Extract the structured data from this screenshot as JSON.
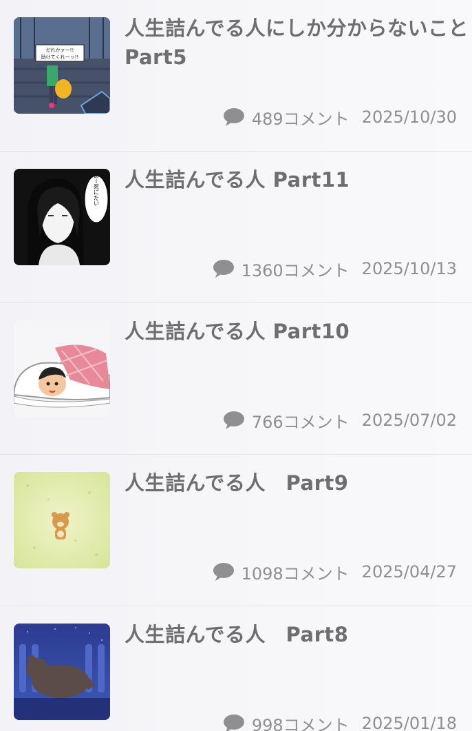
{
  "items": [
    {
      "title": "人生詰んでる人にしか分からないことPart5",
      "comments": "489コメント",
      "date": "2025/10/30",
      "thumb_text": [
        "だれかァー!!",
        "助けてくれーッ!!"
      ]
    },
    {
      "title": "人生詰んでる人 Part11",
      "comments": "1360コメント",
      "date": "2025/10/13",
      "thumb_text": [
        "あー死にたい"
      ]
    },
    {
      "title": "人生詰んでる人 Part10",
      "comments": "766コメント",
      "date": "2025/07/02"
    },
    {
      "title": "人生詰んでる人　Part9",
      "comments": "1098コメント",
      "date": "2025/04/27"
    },
    {
      "title": "人生詰んでる人　Part8",
      "comments": "998コメント",
      "date": "2025/01/18"
    }
  ],
  "icons": {
    "comment": "speech-bubble-icon"
  },
  "colors": {
    "text": "#6e6e70",
    "meta": "#8e8e93",
    "divider": "#e3e3e8"
  }
}
